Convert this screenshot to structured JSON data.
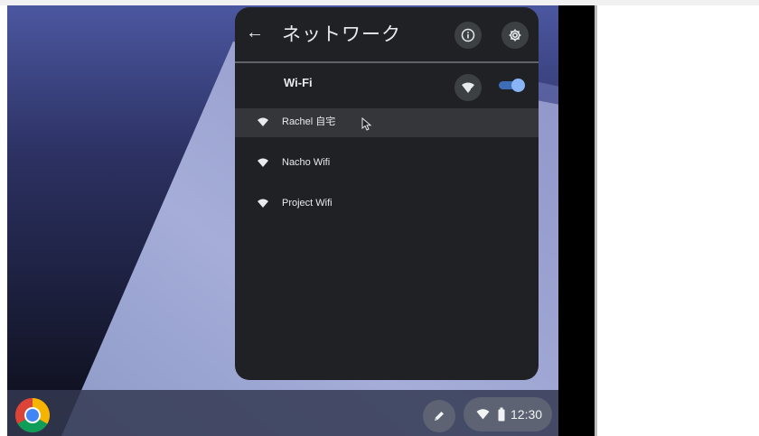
{
  "network_panel": {
    "title": "ネットワーク",
    "back_label": "←",
    "wifi_label": "Wi-Fi",
    "wifi_enabled": true,
    "networks": [
      {
        "name": "Rachel 自宅",
        "highlighted": true
      },
      {
        "name": "Nacho Wifi",
        "highlighted": false
      },
      {
        "name": "Project Wifi",
        "highlighted": false
      }
    ]
  },
  "shelf": {
    "time": "12:30"
  },
  "colors": {
    "panel_bg": "#202124",
    "accent": "#8ab4f8",
    "shelf": "#343a52"
  },
  "icons": [
    "back-arrow-icon",
    "info-icon",
    "gear-icon",
    "add-wifi-icon",
    "wifi-icon",
    "chrome-icon",
    "stylus-icon",
    "battery-icon",
    "mouse-cursor-icon"
  ]
}
